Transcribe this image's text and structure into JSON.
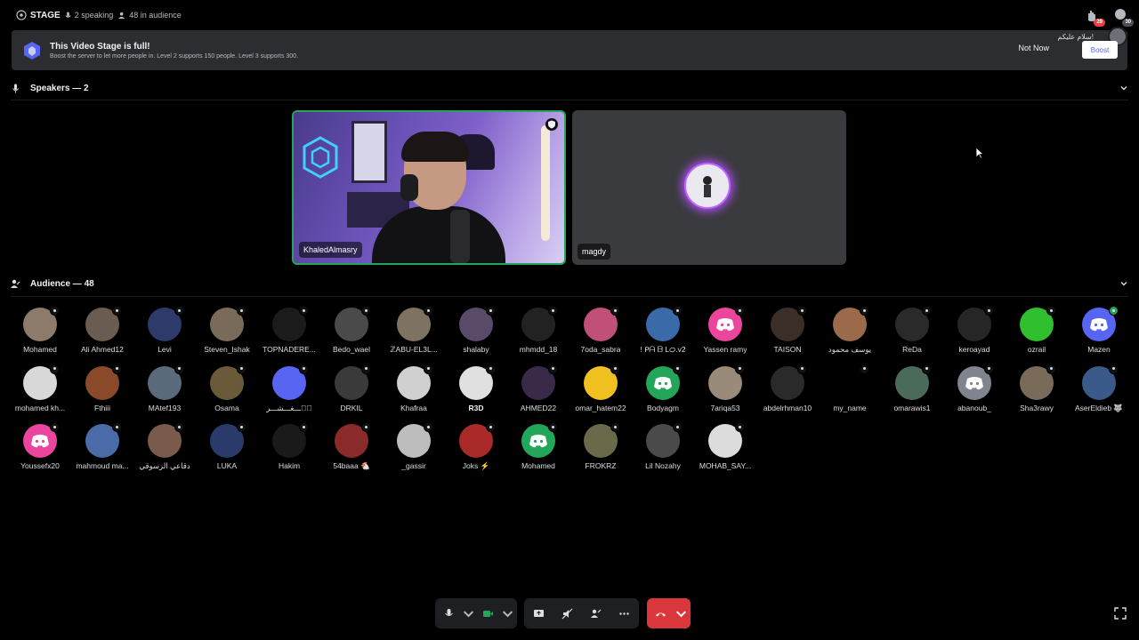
{
  "topbar": {
    "stage_label": "STAGE",
    "speaking": "2 speaking",
    "audience_count": "48 in audience",
    "badge_raise": "29",
    "badge_notif": "30"
  },
  "banner": {
    "title": "This Video Stage is full!",
    "subtitle": "Boost the server to let more people in. Level 2 supports 150 people. Level 3 supports 300.",
    "not_now": "Not Now",
    "boost": "Boost",
    "toast": "سلام عليكم!"
  },
  "speakers": {
    "header": "Speakers — 2",
    "tiles": [
      {
        "name": "KhaledAlmasry"
      },
      {
        "name": "magdy"
      }
    ]
  },
  "audience": {
    "header": "Audience — 48",
    "members": [
      {
        "name": "Mohamed",
        "color": "#8c7a6b"
      },
      {
        "name": "Ali Ahmed12",
        "color": "#6b5c52"
      },
      {
        "name": "Levi",
        "color": "#2d3a6a"
      },
      {
        "name": "Steven_Ishak",
        "color": "#7a6a5a"
      },
      {
        "name": "TOPNADERE...",
        "color": "#1b1b1b"
      },
      {
        "name": "Bedo_wael",
        "color": "#4a4a4a"
      },
      {
        "name": "ℤABU-EL3L...",
        "color": "#7e7262"
      },
      {
        "name": "shalaby",
        "color": "#5a4a6a"
      },
      {
        "name": "mhmdd_18",
        "color": "#222"
      },
      {
        "name": "7oda_sabra",
        "color": "#c0507a"
      },
      {
        "name": "! ᑭᗩ ᗷ Lᝪ.v2",
        "color": "#3a6aa8"
      },
      {
        "name": "Yassen ramy",
        "color": "#eb459e",
        "discord": true
      },
      {
        "name": "TAISON",
        "color": "#3a2e26"
      },
      {
        "name": "يوسف محمود",
        "color": "#9a6a4a"
      },
      {
        "name": "ReDa",
        "color": "#2a2a2a"
      },
      {
        "name": "keroayad",
        "color": "#262626"
      },
      {
        "name": "ozrail",
        "color": "#2fbf2f"
      },
      {
        "name": "Mazen",
        "color": "#5865f2",
        "discord": true,
        "green": true
      },
      {
        "name": "mohamed kh...",
        "color": "#d8d8d8"
      },
      {
        "name": "Fthiii",
        "color": "#8a4a2a"
      },
      {
        "name": "MAtef193",
        "color": "#5a6a7a"
      },
      {
        "name": "Osama",
        "color": "#6a5a3a"
      },
      {
        "name": "ع۪ـــغـــشـــر",
        "color": "#5865f2"
      },
      {
        "name": "DRKIL",
        "color": "#3a3a3a"
      },
      {
        "name": "Khafraa",
        "color": "#d0d0d0"
      },
      {
        "name": "R3D",
        "color": "#e0e0e0",
        "bold": true
      },
      {
        "name": "AHMED22",
        "color": "#3a2a4a"
      },
      {
        "name": "omar_hatem22",
        "color": "#f0c020"
      },
      {
        "name": "Bodyagm",
        "color": "#23a55a",
        "discord": true
      },
      {
        "name": "7ariqa53",
        "color": "#9a8a7a"
      },
      {
        "name": "abdelrhman10",
        "color": "#2a2a2a"
      },
      {
        "name": "my_name",
        "color": "#000000"
      },
      {
        "name": "omarawis1",
        "color": "#4a6a5a"
      },
      {
        "name": "abanoub_",
        "color": "#80848e",
        "discord": true
      },
      {
        "name": "Sha3rawy",
        "color": "#7a6a5a"
      },
      {
        "name": "AserEldieb 🐺",
        "color": "#3a5a8a"
      },
      {
        "name": "Youssefx20",
        "color": "#eb459e",
        "discord": true
      },
      {
        "name": "mahmoud ma...",
        "color": "#4a6aa8"
      },
      {
        "name": "دقاعي الزسوقي",
        "color": "#7a5a4a"
      },
      {
        "name": "LUKA",
        "color": "#2a3a6a"
      },
      {
        "name": "Hakim",
        "color": "#1a1a1a"
      },
      {
        "name": "54baaa 🐔",
        "color": "#8a2a2a"
      },
      {
        "name": "_gassir",
        "color": "#bdbdbd"
      },
      {
        "name": "Joks ⚡",
        "color": "#aa2a2a"
      },
      {
        "name": "Mohamed",
        "color": "#23a55a",
        "discord": true
      },
      {
        "name": "FROKRZ",
        "color": "#6a6a4a"
      },
      {
        "name": "Lil Nozahy",
        "color": "#4a4a4a"
      },
      {
        "name": "MOHAB_SAY...",
        "color": "#dcdcdc"
      }
    ]
  },
  "colors": {
    "accent": "#5865f2",
    "speaking_border": "#23a55a",
    "leave": "#da373c",
    "banner_bg": "#2b2d31"
  }
}
